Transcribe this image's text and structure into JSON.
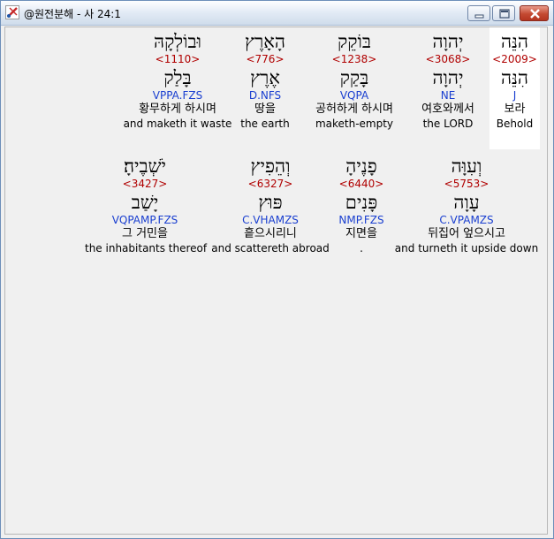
{
  "window": {
    "title": "@원전분해 - 사 24:1",
    "buttons": {
      "minimize": "minimize",
      "maximize": "maximize",
      "close": "close"
    },
    "icons": {
      "app": "app-cross-icon"
    }
  },
  "rows": [
    {
      "words": [
        {
          "hebrew": "הִנֵּה",
          "strong": "<2009>",
          "root": "הִנֵּה",
          "morph": "J",
          "korean": "보라",
          "english": "Behold",
          "highlight": true
        },
        {
          "hebrew": "יְהוָה",
          "strong": "<3068>",
          "root": "יְהוָה",
          "morph": "NE",
          "korean": "여호와께서",
          "english": "the LORD",
          "highlight": false
        },
        {
          "hebrew": "בּוֹקֵק",
          "strong": "<1238>",
          "root": "בָּקַק",
          "morph": "VQPA",
          "korean": "공허하게 하시며",
          "english": "maketh-empty",
          "highlight": false
        },
        {
          "hebrew": "הָאָרֶץ",
          "strong": "<776>",
          "root": "אֶרֶץ",
          "morph": "D.NFS",
          "korean": "땅을",
          "english": "the earth",
          "highlight": false
        },
        {
          "hebrew": "וּבוֹלְקָהּ",
          "strong": "<1110>",
          "root": "בָּלַק",
          "morph": "VPPA.FZS",
          "korean": "황무하게 하시며",
          "english": "and maketh it waste",
          "highlight": false
        }
      ]
    },
    {
      "words": [
        {
          "hebrew": "וְעִוָּה",
          "strong": "<5753>",
          "root": "עָוָה",
          "morph": "C.VPAMZS",
          "korean": "뒤집어 엎으시고",
          "english": "and turneth it upside down",
          "highlight": false
        },
        {
          "hebrew": "פָנֶיהָ",
          "strong": "<6440>",
          "root": "פָּנִים",
          "morph": "NMP.FZS",
          "korean": "지면을",
          "english": ".",
          "highlight": false
        },
        {
          "hebrew": "וְהֵפִיץ",
          "strong": "<6327>",
          "root": "פּוּץ",
          "morph": "C.VHAMZS",
          "korean": "흩으시리니",
          "english": "and scattereth abroad",
          "highlight": false
        },
        {
          "hebrew": "יֹשְׁבֶיהָ׃",
          "strong": "<3427>",
          "root": "יָשַׁב",
          "morph": "VQPAMP.FZS",
          "korean": "그 거민을",
          "english": "the inhabitants thereof",
          "highlight": false
        }
      ]
    }
  ]
}
